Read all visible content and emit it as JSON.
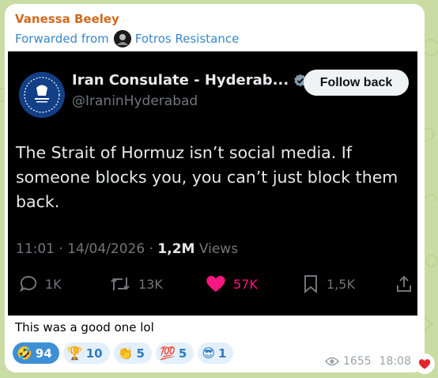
{
  "message": {
    "sender": "Vanessa Beeley",
    "forwarded_prefix": "Forwarded from",
    "forwarded_channel": "Fotros Resistance",
    "caption": "This was a good one lol",
    "views": "1655",
    "time": "18:08"
  },
  "tweet": {
    "display_name": "Iran Consulate - Hyderab...",
    "handle": "@IraninHyderabad",
    "follow_label": "Follow back",
    "text": "The Strait of Hormuz isn’t social media. If someone blocks you, you can’t just block them back.",
    "timestamp": "11:01 · 14/04/2026 · ",
    "views_count": "1,2M",
    "views_label": " Views",
    "replies": "1K",
    "reposts": "13K",
    "likes": "57K",
    "bookmarks": "1,5K"
  },
  "reactions": [
    {
      "emoji": "🤣",
      "count": "94"
    },
    {
      "emoji": "🏆",
      "count": "10"
    },
    {
      "emoji": "👏",
      "count": "5"
    },
    {
      "emoji": "💯",
      "count": "5"
    },
    {
      "emoji": "😎",
      "count": "1"
    }
  ],
  "colors": {
    "sender": "#d2691e",
    "link": "#3a87c9",
    "like": "#f91880",
    "background": "#c9dca4"
  }
}
